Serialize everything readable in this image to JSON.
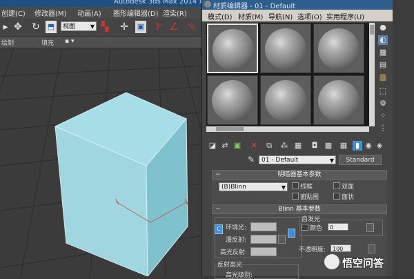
{
  "main_window": {
    "title": "Autodesk 3ds Max  2014 x",
    "menus": [
      "创建(C)",
      "修改器(M)",
      "动画(A)",
      "图形编辑器(D)",
      "渲染(R)"
    ],
    "view_dropdown": "视图",
    "ribbon": [
      "绘制",
      "填充"
    ]
  },
  "material_editor": {
    "title": "材质编辑器 - 01 - Default",
    "menus": [
      "模式(D)",
      "材质(M)",
      "导航(N)",
      "选项(O)",
      "实用程序(U)"
    ],
    "material_name": "01 - Default",
    "material_type_button": "Standard",
    "shader_rollout": {
      "title": "明暗器基本参数",
      "shader": "(B)Blinn",
      "options": [
        "线框",
        "双面",
        "面贴图",
        "面状"
      ]
    },
    "blinn_rollout": {
      "title": "Blinn 基本参数",
      "self_illum_group": "自发光",
      "color_label": "颜色",
      "color_value": "0",
      "ambient_label": "环境光:",
      "diffuse_label": "漫反射:",
      "specular_label": "高光反射:",
      "opacity_label": "不透明度:",
      "opacity_value": "100",
      "lock_glyph": "C",
      "specular_highlights_group": "反射高光",
      "specular_level_label": "高光级别:"
    }
  },
  "watermark": {
    "text": "悟空问答"
  }
}
